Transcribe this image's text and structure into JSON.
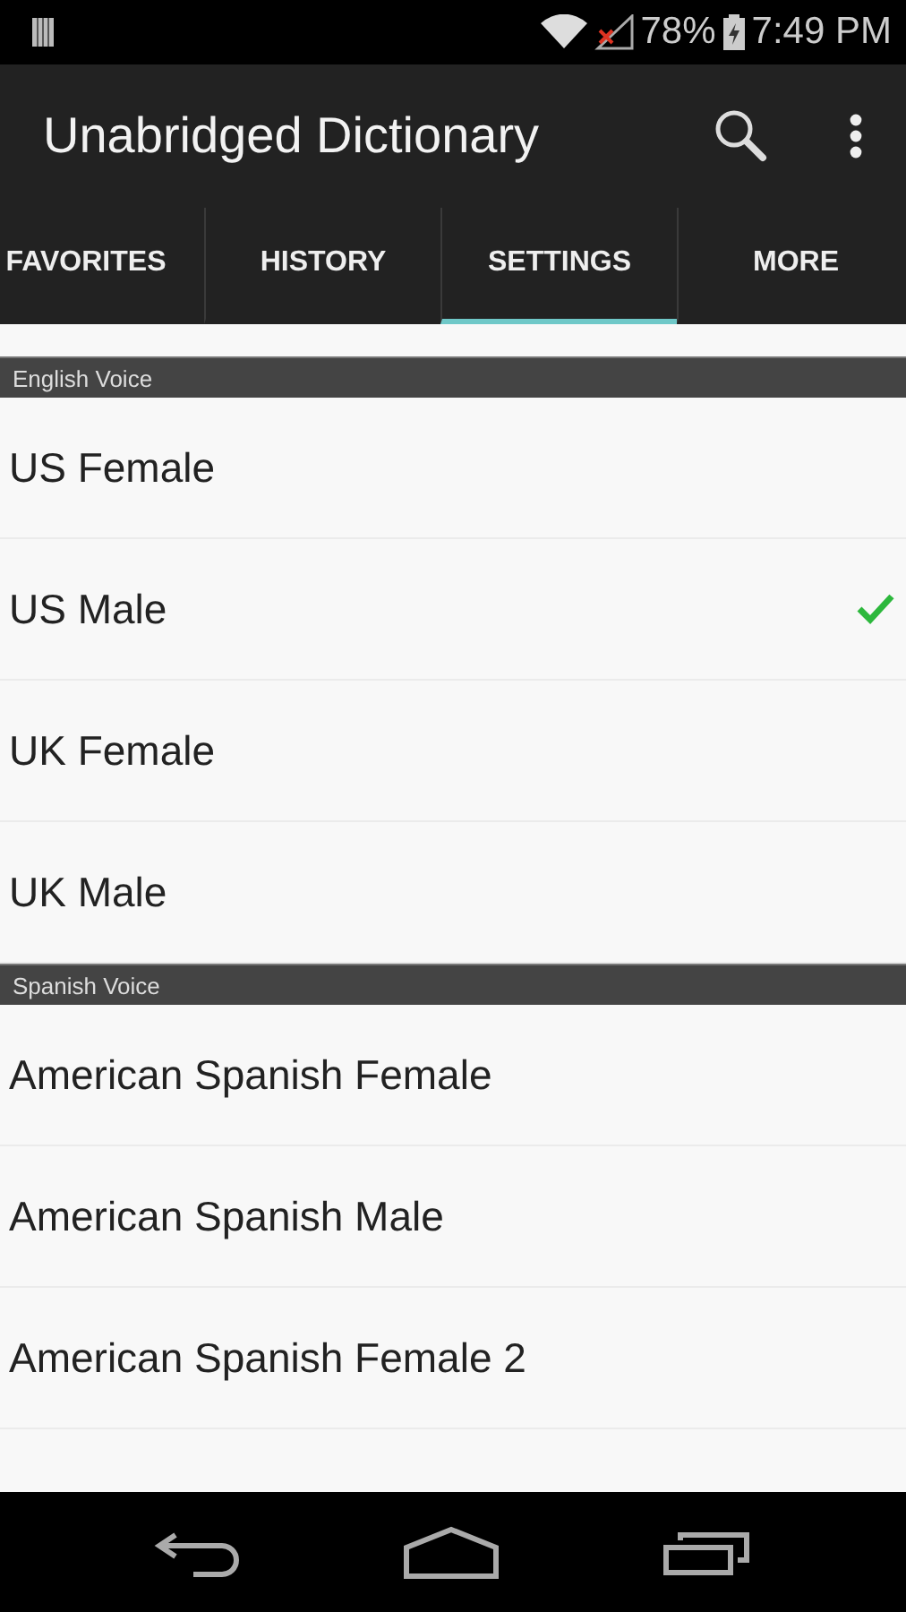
{
  "status_bar": {
    "battery": "78%",
    "time": "7:49 PM"
  },
  "app_bar": {
    "title": "Unabridged Dictionary"
  },
  "tabs": [
    {
      "label": "FAVORITES",
      "selected": false
    },
    {
      "label": "HISTORY",
      "selected": false
    },
    {
      "label": "SETTINGS",
      "selected": true
    },
    {
      "label": "MORE",
      "selected": false
    }
  ],
  "sections": [
    {
      "header": "English Voice",
      "items": [
        {
          "label": "US Female",
          "selected": false
        },
        {
          "label": "US Male",
          "selected": true
        },
        {
          "label": "UK Female",
          "selected": false
        },
        {
          "label": "UK Male",
          "selected": false
        }
      ]
    },
    {
      "header": "Spanish Voice",
      "items": [
        {
          "label": "American Spanish Female",
          "selected": false
        },
        {
          "label": "American Spanish Male",
          "selected": false
        },
        {
          "label": "American Spanish Female 2",
          "selected": false
        }
      ]
    }
  ]
}
